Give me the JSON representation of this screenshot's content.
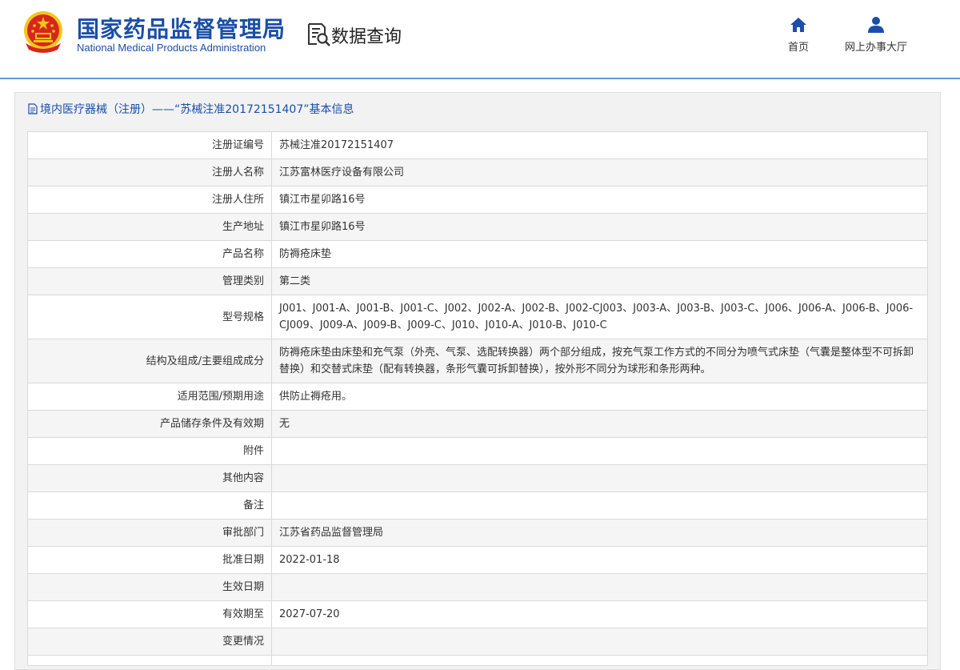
{
  "header": {
    "brand_cn": "国家药品监督管理局",
    "brand_en": "National Medical Products Administration",
    "query_label": "数据查询",
    "nav": [
      {
        "label": "首页",
        "icon": "home-icon"
      },
      {
        "label": "网上办事大厅",
        "icon": "user-icon"
      }
    ]
  },
  "panel": {
    "title": "境内医疗器械（注册）——“苏械注准20172151407”基本信息"
  },
  "rows": [
    {
      "label": "注册证编号",
      "value": "苏械注准20172151407"
    },
    {
      "label": "注册人名称",
      "value": "江苏富林医疗设备有限公司"
    },
    {
      "label": "注册人住所",
      "value": "镇江市星卯路16号"
    },
    {
      "label": "生产地址",
      "value": "镇江市星卯路16号"
    },
    {
      "label": "产品名称",
      "value": "防褥疮床垫"
    },
    {
      "label": "管理类别",
      "value": "第二类"
    },
    {
      "label": "型号规格",
      "value": "J001、J001-A、J001-B、J001-C、J002、J002-A、J002-B、J002-CJ003、J003-A、J003-B、J003-C、J006、J006-A、J006-B、J006-CJ009、J009-A、J009-B、J009-C、J010、J010-A、J010-B、J010-C"
    },
    {
      "label": "结构及组成/主要组成成分",
      "value": "防褥疮床垫由床垫和充气泵（外壳、气泵、选配转换器）两个部分组成，按充气泵工作方式的不同分为喷气式床垫（气囊是整体型不可拆卸替换）和交替式床垫（配有转换器，条形气囊可拆卸替换），按外形不同分为球形和条形两种。"
    },
    {
      "label": "适用范围/预期用途",
      "value": "供防止褥疮用。"
    },
    {
      "label": "产品储存条件及有效期",
      "value": "无"
    },
    {
      "label": "附件",
      "value": ""
    },
    {
      "label": "其他内容",
      "value": ""
    },
    {
      "label": "备注",
      "value": ""
    },
    {
      "label": "审批部门",
      "value": "江苏省药品监督管理局"
    },
    {
      "label": "批准日期",
      "value": "2022-01-18"
    },
    {
      "label": "生效日期",
      "value": ""
    },
    {
      "label": "有效期至",
      "value": "2027-07-20"
    },
    {
      "label": "变更情况",
      "value": ""
    },
    {
      "label": "",
      "value": ""
    }
  ],
  "colors": {
    "brand_blue": "#1a4ea8",
    "header_line": "#5b9bd5",
    "emblem_red": "#d7261e",
    "emblem_gold": "#f5c518"
  }
}
